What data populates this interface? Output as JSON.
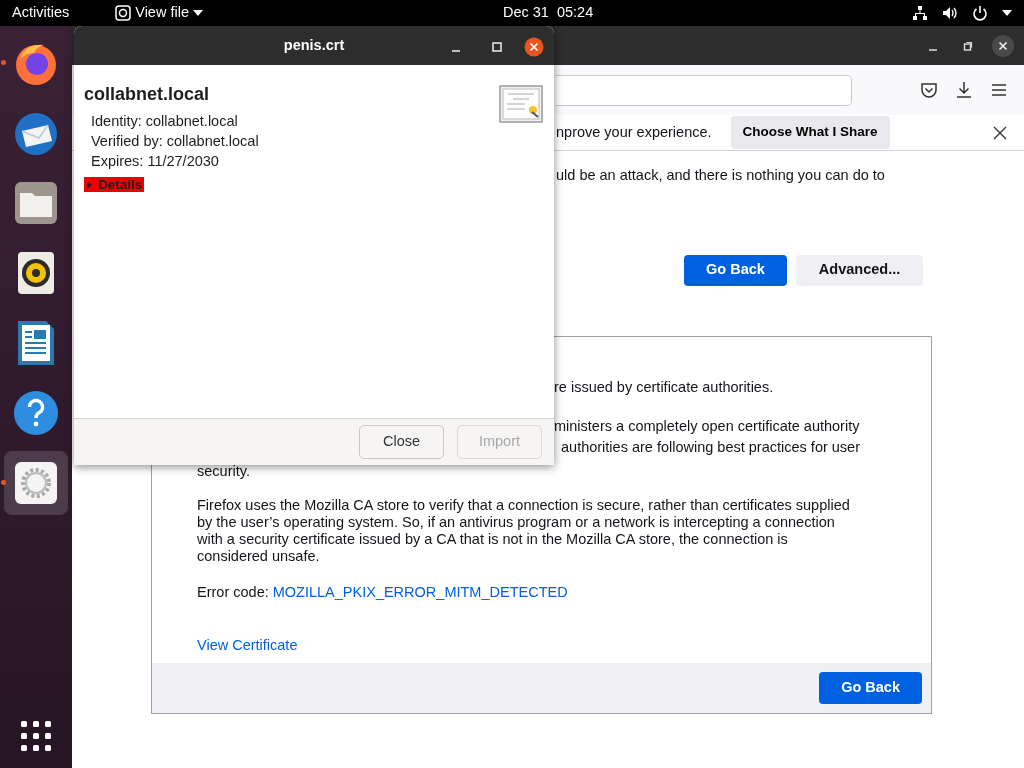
{
  "top_bar": {
    "activities": "Activities",
    "app_menu": "View file",
    "clock": "Dec 31  05:24"
  },
  "dock": {
    "apps": [
      {
        "kind": "firefox",
        "running": true,
        "selected": false
      },
      {
        "kind": "thunderbird",
        "running": false,
        "selected": false
      },
      {
        "kind": "files",
        "running": false,
        "selected": false
      },
      {
        "kind": "rhythmbox",
        "running": false,
        "selected": false
      },
      {
        "kind": "writer",
        "running": false,
        "selected": false
      },
      {
        "kind": "help",
        "running": false,
        "selected": false
      },
      {
        "kind": "settings",
        "running": true,
        "selected": true
      }
    ]
  },
  "browser": {
    "notification": {
      "text": "nprove your experience.",
      "button": "Choose What I Share"
    },
    "intro_fragment": "uld be an attack, and there is nothing you can do to",
    "buttons": [
      {
        "label": "Go Back",
        "kind": "primary"
      },
      {
        "label": "Advanced...",
        "kind": "secondary"
      }
    ],
    "advanced_panel": {
      "fragments": [
        "re issued by certificate authorities.",
        "ministers a completely open certificate authority",
        "authorities are following best practices for user"
      ],
      "continuation": "security.",
      "paragraph": "Firefox uses the Mozilla CA store to verify that a connection is secure, rather than certificates supplied by the user’s operating system. So, if an antivirus program or a network is intercepting a connection with a security certificate issued by a CA that is not in the Mozilla CA store, the connection is considered unsafe.",
      "error_label": "Error code:",
      "error_code": "MOZILLA_PKIX_ERROR_MITM_DETECTED",
      "view_certificate": "View Certificate",
      "go_back": "Go Back"
    }
  },
  "dialog": {
    "title": "penis.crt",
    "heading": "collabnet.local",
    "fields": [
      "Identity: collabnet.local",
      "Verified by: collabnet.local",
      "Expires: 11/27/2030"
    ],
    "details": {
      "label": "Details",
      "expanded": false,
      "highlighted": true
    },
    "buttons": [
      {
        "label": "Close",
        "disabled": false
      },
      {
        "label": "Import",
        "disabled": true
      }
    ]
  }
}
